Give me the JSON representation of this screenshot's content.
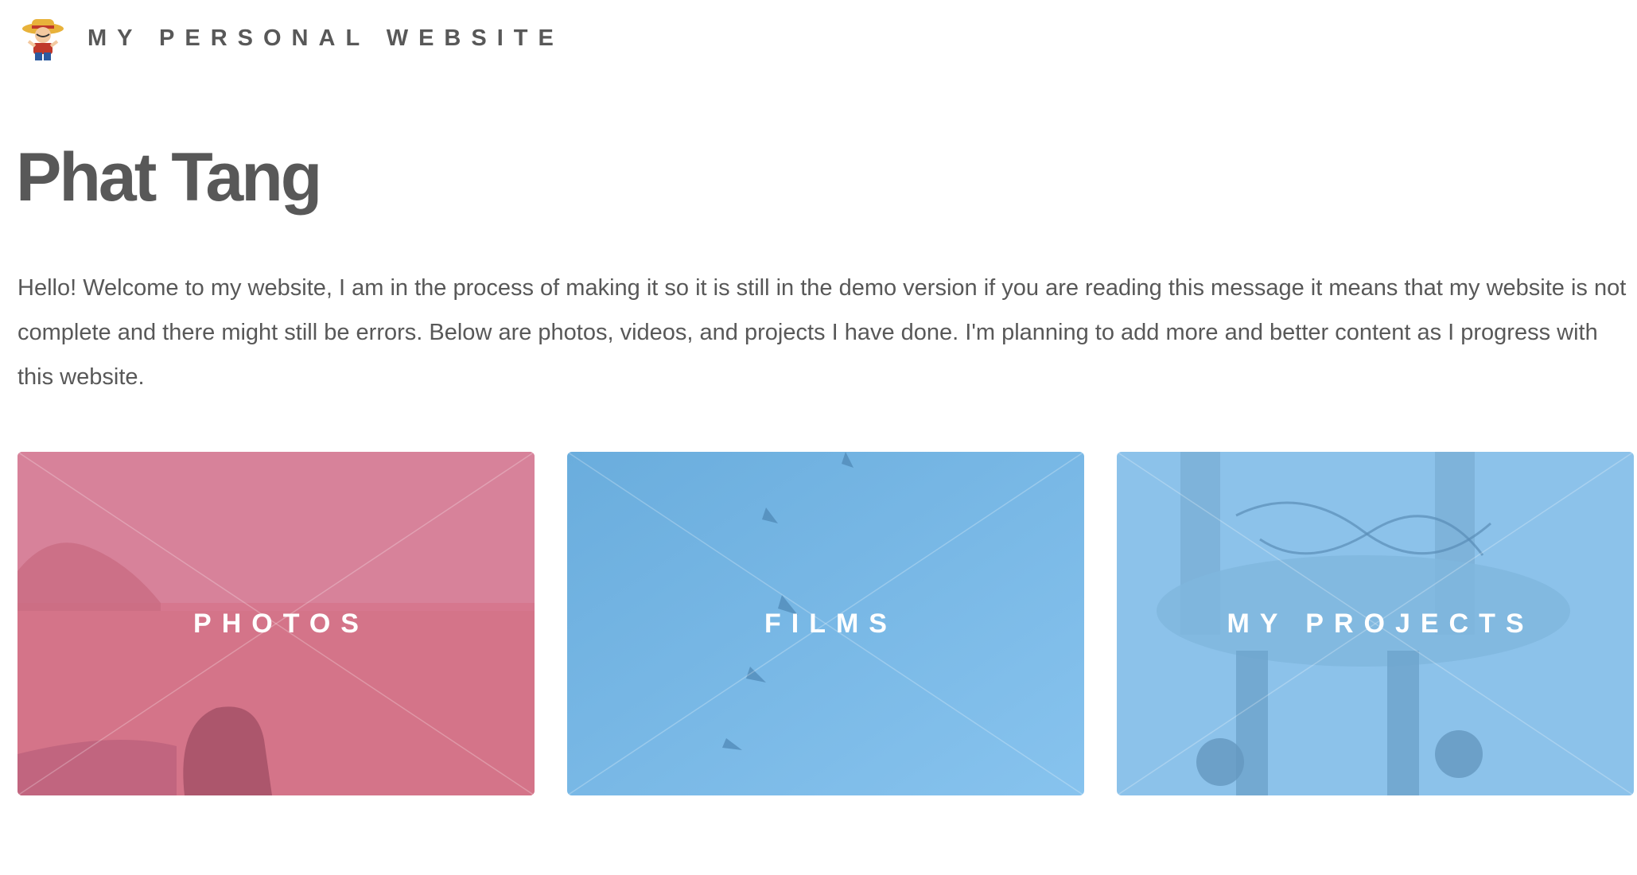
{
  "header": {
    "site_name": "MY PERSONAL WEBSITE",
    "logo_icon": "cartoon-pirate-avatar"
  },
  "title": "Phat Tang",
  "intro": "Hello! Welcome to my website, I am in the process of making it so it is still in the demo version if you are reading this message it means that my website is not complete and there might still be errors. Below are photos, videos, and projects I have done. I'm planning to add more and better content as I progress with this website.",
  "tiles": [
    {
      "label": "PHOTOS",
      "color": "#d6778e"
    },
    {
      "label": "FILMS",
      "color": "#74b3e3"
    },
    {
      "label": "MY PROJECTS",
      "color": "#8cc2ea"
    }
  ],
  "colors": {
    "text": "#585858",
    "background": "#ffffff"
  }
}
